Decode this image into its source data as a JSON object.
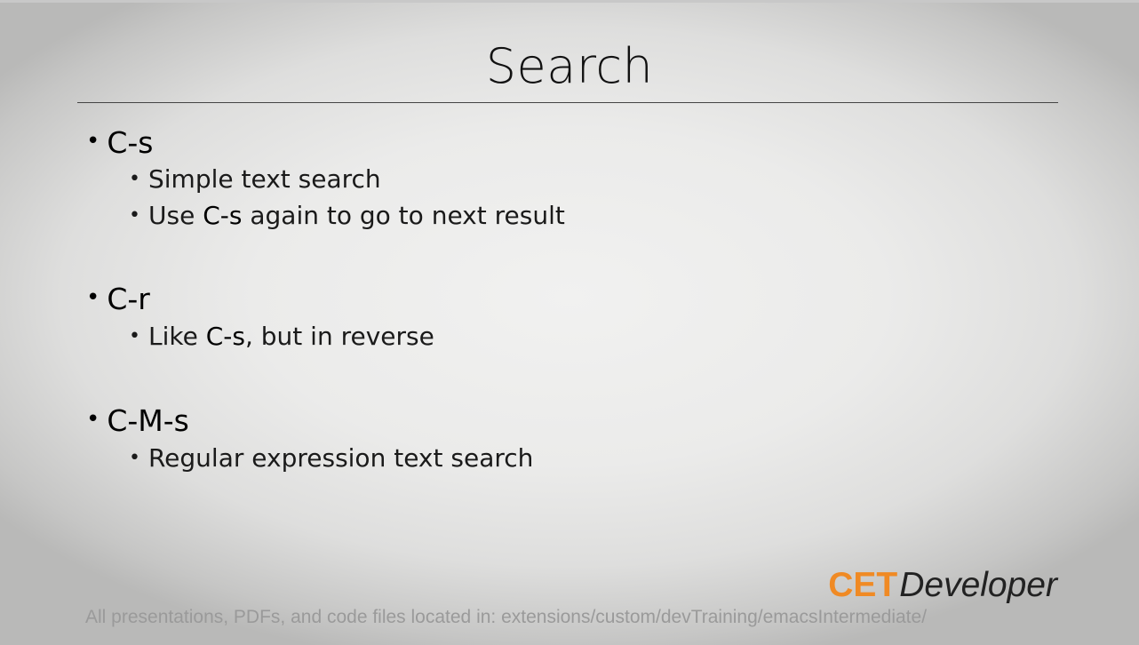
{
  "slide": {
    "title": "Search",
    "bullets": [
      {
        "label": "C-s",
        "sub": [
          {
            "text": "Simple text search"
          },
          {
            "before": "Use ",
            "key": "C-s",
            "after": " again to go to next result"
          }
        ]
      },
      {
        "label": "C-r",
        "sub": [
          {
            "before": "Like ",
            "key": "C-s",
            "after": ", but in reverse"
          }
        ]
      },
      {
        "label": "C-M-s",
        "sub": [
          {
            "text": "Regular expression text search"
          }
        ]
      }
    ],
    "bullet_glyph": "•",
    "logo": {
      "part1": "CET",
      "part2": "Developer",
      "accent_color": "#f08a24"
    },
    "footer": "All presentations, PDFs, and code files located in: extensions/custom/devTraining/emacsIntermediate/"
  }
}
